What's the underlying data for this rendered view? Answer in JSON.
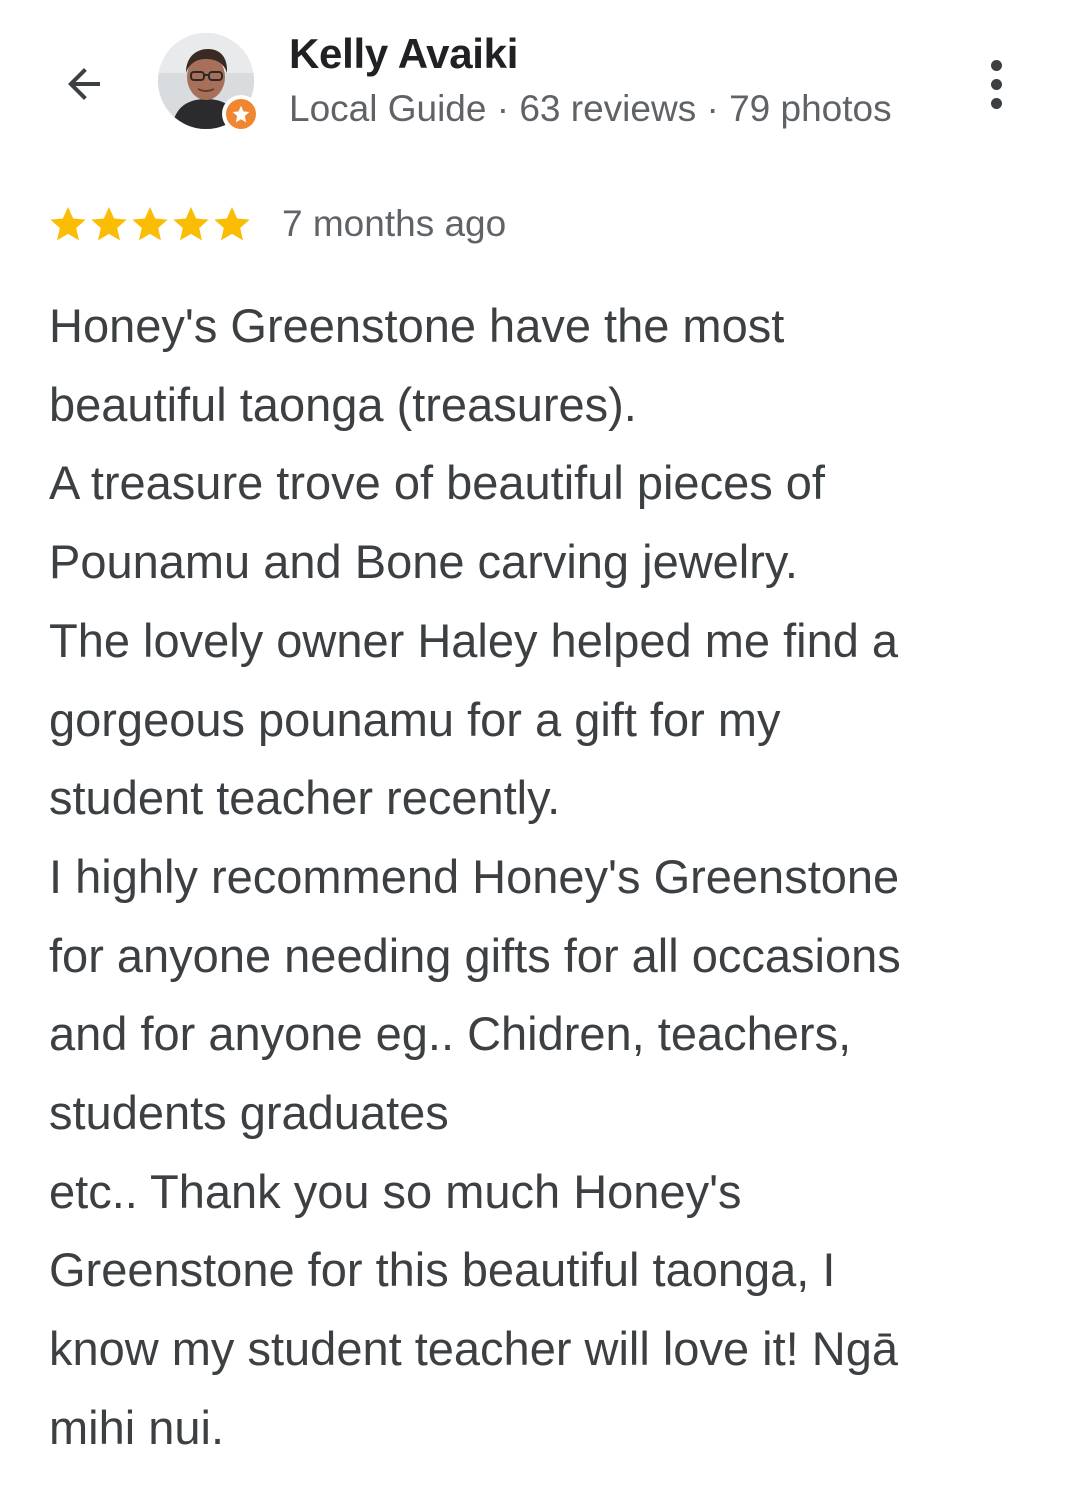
{
  "reviewer": {
    "name": "Kelly Avaiki",
    "meta": "Local Guide · 63 reviews · 79 photos"
  },
  "icons": {
    "back": "arrow-back-icon",
    "more": "more-vert-icon",
    "badge": "local-guide-star-icon",
    "rating_star": "star-filled-icon"
  },
  "colors": {
    "star": "#fbbc04",
    "badge": "#f0862f",
    "secondary_text": "#5f6368",
    "body_text": "#3c4043"
  },
  "review": {
    "rating": 5,
    "rating_max": 5,
    "date": "7 months ago",
    "lines": [
      "Honey's Greenstone have the most",
      "beautiful taonga (treasures).",
      "A treasure trove of beautiful pieces of",
      "Pounamu and Bone carving jewelry.",
      "The lovely owner Haley helped me find a",
      "gorgeous pounamu for a gift for my",
      "student teacher recently.",
      "I highly recommend Honey's Greenstone",
      "for anyone needing gifts for all occasions",
      "and for anyone eg.. Chidren, teachers,",
      "students graduates",
      "etc.. Thank you so much Honey's",
      "Greenstone for this beautiful taonga, I",
      "know my student teacher will love it! Ngā",
      "mihi nui."
    ]
  }
}
